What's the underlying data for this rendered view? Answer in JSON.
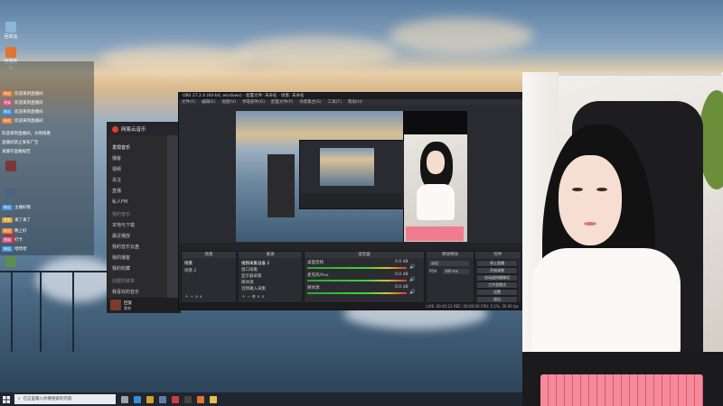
{
  "desktop": {
    "icons": [
      {
        "name": "app-icon-1",
        "label": "回收站",
        "color": "#8bb6d9"
      },
      {
        "name": "app-icon-2",
        "label": "直播助手",
        "color": "#e0762f"
      },
      {
        "name": "app-icon-3",
        "label": "",
        "color": "#c23a3a"
      },
      {
        "name": "app-icon-4",
        "label": "",
        "color": "#6b8fb5"
      },
      {
        "name": "app-icon-5",
        "label": "",
        "color": "#cf5c5c"
      },
      {
        "name": "app-icon-6",
        "label": "",
        "color": "#5b8f4e"
      }
    ]
  },
  "chat": {
    "messages": [
      {
        "badge": "粉丝",
        "color": "#e07a2f",
        "text": "欢迎来到直播间"
      },
      {
        "badge": "贵族",
        "color": "#d24f80",
        "text": "欢迎来到直播间"
      },
      {
        "badge": "粉丝",
        "color": "#3f8fd8",
        "text": "欢迎来到直播间"
      },
      {
        "badge": "粉丝",
        "color": "#e07a2f",
        "text": "欢迎来到直播间"
      },
      {
        "badge": "",
        "color": "#4c8e4c",
        "text": "欢迎来到直播间，文明观看"
      },
      {
        "badge": "",
        "color": "#4c8e4c",
        "text": "直播间禁止发布广告"
      },
      {
        "badge": "",
        "color": "#4c8e4c",
        "text": "请遵守直播规范"
      },
      {
        "badge": "粉丝",
        "color": "#3f8fd8",
        "text": "主播好看"
      },
      {
        "badge": "贵族",
        "color": "#d99a2b",
        "text": "来了来了"
      },
      {
        "badge": "粉丝",
        "color": "#e07a2f",
        "text": "晚上好"
      },
      {
        "badge": "贵族",
        "color": "#d24f80",
        "text": "打卡"
      },
      {
        "badge": "粉丝",
        "color": "#3f8fd8",
        "text": "哈哈哈"
      }
    ]
  },
  "music": {
    "app_name": "网易云音乐",
    "menu": [
      "发现音乐",
      "播客",
      "视频",
      "关注",
      "直播",
      "私人FM",
      "我的音乐",
      "本地与下载",
      "最近播放",
      "我的音乐云盘",
      "我的播客",
      "我的收藏",
      "创建的歌单",
      "我喜欢的音乐"
    ],
    "now_playing": "回旋",
    "artist": "霍尊"
  },
  "obs": {
    "title": "OBS 27.2.4 (64-bit, windows) - 配置文件: 未命名 - 场景: 未命名",
    "menu": [
      "文件(F)",
      "编辑(E)",
      "视图(V)",
      "停靠部件(D)",
      "配置文件(P)",
      "场景集合(S)",
      "工具(T)",
      "帮助(H)"
    ],
    "source_hint": "未选择源",
    "docks": {
      "scenes": {
        "title": "场景",
        "items": [
          "场景",
          "场景 2"
        ]
      },
      "sources": {
        "title": "来源",
        "items": [
          "视频采集设备 2",
          "窗口采集",
          "显示器采集",
          "媒体源",
          "音频输入采集"
        ]
      },
      "mixer": {
        "title": "混音器",
        "channels": [
          {
            "name": "桌面音频",
            "db": "0.0 dB"
          },
          {
            "name": "麦克风/Aux",
            "db": "0.0 dB"
          },
          {
            "name": "媒体源",
            "db": "0.0 dB"
          }
        ]
      },
      "transitions": {
        "title": "转场特效",
        "effect": "淡出",
        "duration_label": "时长",
        "duration": "300 ms"
      },
      "controls": {
        "title": "控件",
        "buttons": [
          "停止直播",
          "开始录制",
          "启动虚拟摄像机",
          "工作室模式",
          "设置",
          "退出"
        ]
      }
    },
    "status": "LIVE: 00:45:21  REC: 00:00:00  CPU: 5.1%, 30.00 fps"
  },
  "taskbar": {
    "search_placeholder": "在这里输入你要搜索的内容",
    "apps": [
      {
        "name": "taskview-icon",
        "color": "#9aa3ad"
      },
      {
        "name": "edge-icon",
        "color": "#2f8fd8"
      },
      {
        "name": "chrome-icon",
        "color": "#d7a032"
      },
      {
        "name": "steam-icon",
        "color": "#5e7ea6"
      },
      {
        "name": "netease-music-icon",
        "color": "#d23a3a"
      },
      {
        "name": "obs-icon",
        "color": "#444"
      },
      {
        "name": "live-icon",
        "color": "#e0762f"
      },
      {
        "name": "folder-icon",
        "color": "#e7c04a"
      }
    ]
  }
}
